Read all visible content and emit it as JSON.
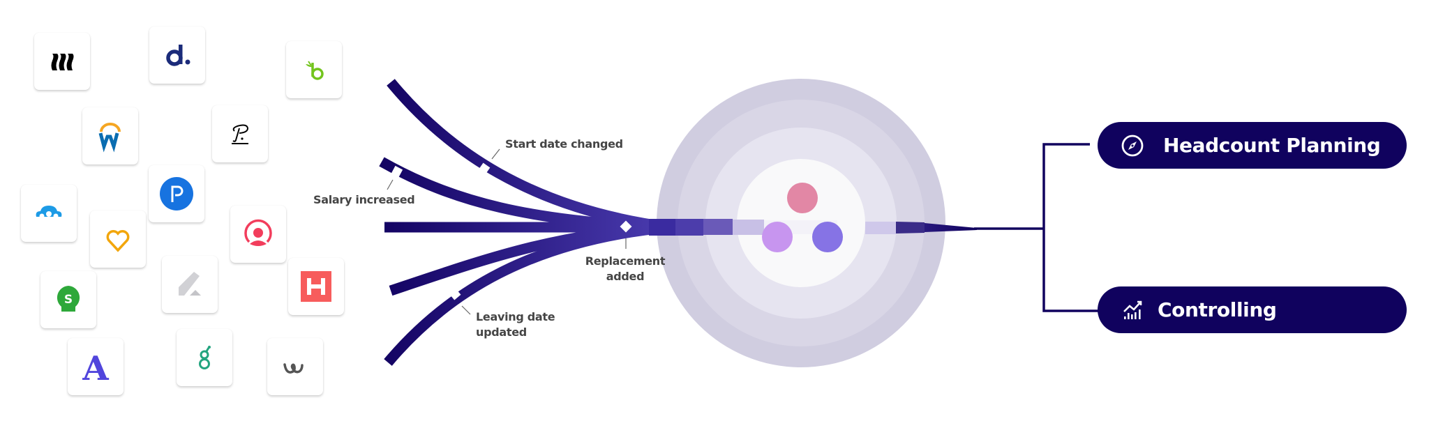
{
  "integrations": [
    {
      "id": "rippling",
      "icon": "rippling-logo-icon",
      "color": "#000000"
    },
    {
      "id": "deel",
      "icon": "deel-logo-icon",
      "color": "#1b2b7a"
    },
    {
      "id": "bamboohr",
      "icon": "bamboohr-logo-icon",
      "color": "#73c41d"
    },
    {
      "id": "workday",
      "icon": "workday-logo-icon",
      "color": "#0a6db1",
      "accent": "#f5a623"
    },
    {
      "id": "personio",
      "icon": "personio-logo-icon",
      "color": "#000000"
    },
    {
      "id": "paylocity",
      "icon": "paylocity-logo-icon",
      "color": "#1773e0"
    },
    {
      "id": "cloud-people",
      "icon": "cloud-people-logo-icon",
      "color": "#1d9be6"
    },
    {
      "id": "heart",
      "icon": "heart-logo-icon",
      "color": "#f2a60c"
    },
    {
      "id": "person-circle",
      "icon": "person-circle-logo-icon",
      "color": "#f23d5c"
    },
    {
      "id": "pencil-a",
      "icon": "pencil-a-logo-icon",
      "color": "#c8c8cc"
    },
    {
      "id": "hibob-h",
      "icon": "h-logo-icon",
      "color": "#f75c5c"
    },
    {
      "id": "s-bulb",
      "icon": "s-bulb-logo-icon",
      "color": "#2ea83a"
    },
    {
      "id": "a-serif",
      "icon": "a-serif-logo-icon",
      "color": "#5145dc"
    },
    {
      "id": "greenhouse",
      "icon": "greenhouse-logo-icon",
      "color": "#23a47f"
    },
    {
      "id": "workable-w",
      "icon": "w-swirl-logo-icon",
      "color": "#555555"
    }
  ],
  "events": {
    "start_date": "Start date changed",
    "salary": "Salary increased",
    "replacement_line1": "Replacement",
    "replacement_line2": "added",
    "leaving_line1": "Leaving date",
    "leaving_line2": "updated"
  },
  "hub": {
    "dots": [
      {
        "name": "pink",
        "color": "#e287a5"
      },
      {
        "name": "lilac",
        "color": "#c795ef"
      },
      {
        "name": "violet",
        "color": "#8673e5"
      }
    ],
    "rings": [
      "#d0cde0",
      "#d9d6e6",
      "#e6e4f0",
      "#f9f9fa"
    ]
  },
  "outputs": {
    "headcount": {
      "label": "Headcount Planning",
      "icon": "compass-icon"
    },
    "controlling": {
      "label": "Controlling",
      "icon": "chart-growth-icon"
    }
  },
  "colors": {
    "navy": "#10025e",
    "flow_start": "#120261",
    "flow_end": "#4b3cb0",
    "label": "#454545"
  }
}
